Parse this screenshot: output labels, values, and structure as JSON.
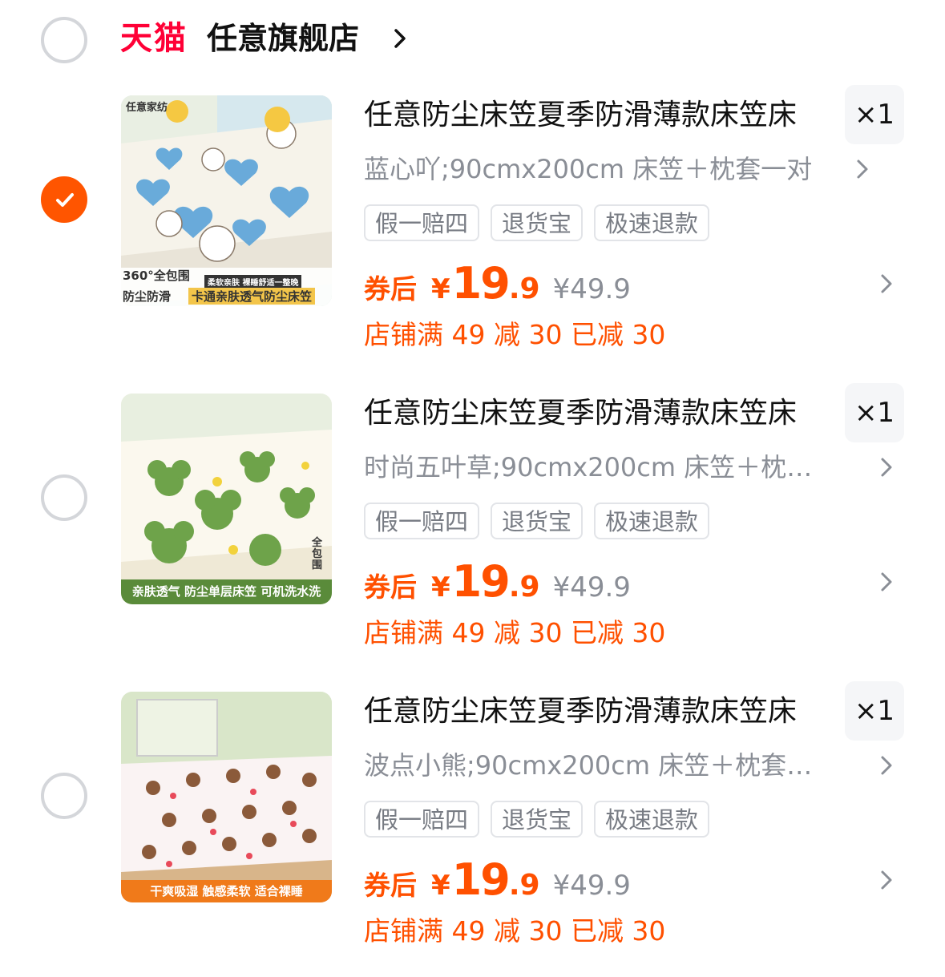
{
  "store": {
    "brand": "天猫",
    "name": "任意旗舰店"
  },
  "items": [
    {
      "title": "任意防尘床笠夏季防滑薄款床笠床",
      "quantity": "×1",
      "sku": "蓝心吖;90cmx200cm 床笠＋枕套一对",
      "tags": [
        "假一赔四",
        "退货宝",
        "极速退款"
      ],
      "coupon_label": "券后",
      "currency": "¥",
      "price_int": "19",
      "price_dec": ".9",
      "original_price": "¥49.9",
      "promo": "店铺满 49 减 30 已减 30",
      "selected": true,
      "image_text": {
        "corner": "任意家纺",
        "badge": "360°全包围",
        "sub": "柔软亲肤 裸睡舒适一整晚",
        "left": "防尘防滑",
        "caption": "卡通亲肤透气防尘床笠"
      }
    },
    {
      "title": "任意防尘床笠夏季防滑薄款床笠床",
      "quantity": "×1",
      "sku": "时尚五叶草;90cmx200cm 床笠＋枕…",
      "tags": [
        "假一赔四",
        "退货宝",
        "极速退款"
      ],
      "coupon_label": "券后",
      "currency": "¥",
      "price_int": "19",
      "price_dec": ".9",
      "original_price": "¥49.9",
      "promo": "店铺满 49 减 30 已减 30",
      "selected": false,
      "image_text": {
        "side": "全包围",
        "caption": "亲肤透气  防尘单层床笠  可机洗水洗"
      }
    },
    {
      "title": "任意防尘床笠夏季防滑薄款床笠床",
      "quantity": "×1",
      "sku": "波点小熊;90cmx200cm 床笠＋枕套…",
      "tags": [
        "假一赔四",
        "退货宝",
        "极速退款"
      ],
      "coupon_label": "券后",
      "currency": "¥",
      "price_int": "19",
      "price_dec": ".9",
      "original_price": "¥49.9",
      "promo": "店铺满 49 减 30 已减 30",
      "selected": false,
      "image_text": {
        "caption": "干爽吸湿  触感柔软  适合裸睡"
      }
    }
  ],
  "colors": {
    "accent": "#ff5500",
    "price": "#ff5000",
    "brand": "#ff0036",
    "muted": "#8a8e96"
  }
}
